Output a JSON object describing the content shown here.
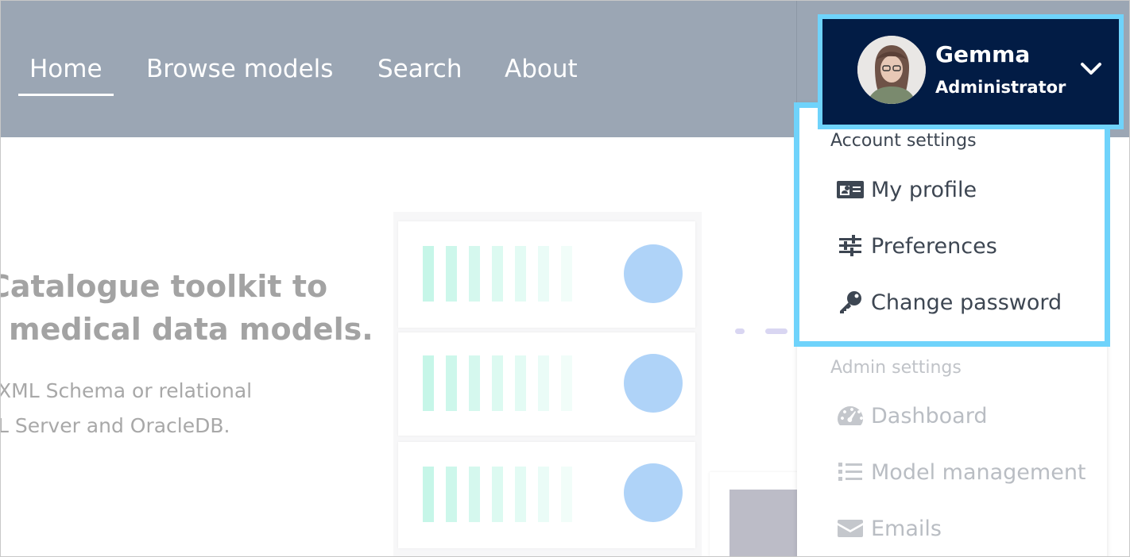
{
  "nav": {
    "items": [
      {
        "label": "Home",
        "active": true
      },
      {
        "label": "Browse models",
        "active": false
      },
      {
        "label": "Search",
        "active": false
      },
      {
        "label": "About",
        "active": false
      }
    ]
  },
  "user": {
    "name": "Gemma",
    "role": "Administrator",
    "avatar_icon": "avatar-photo",
    "chevron_icon": "chevron-down-icon"
  },
  "dropdown": {
    "account_section": {
      "label": "Account settings",
      "items": [
        {
          "label": "My profile",
          "icon": "id-card-icon"
        },
        {
          "label": "Preferences",
          "icon": "sliders-icon"
        },
        {
          "label": "Change password",
          "icon": "key-icon"
        }
      ]
    },
    "admin_section": {
      "label": "Admin settings",
      "items": [
        {
          "label": "Dashboard",
          "icon": "gauge-icon"
        },
        {
          "label": "Model management",
          "icon": "list-icon"
        },
        {
          "label": "Emails",
          "icon": "envelope-icon"
        }
      ]
    }
  },
  "hero": {
    "title_line1": "Catalogue toolkit to",
    "title_line2": "medical data models.",
    "sub_line1": "XML Schema or relational",
    "sub_line2": "L Server and OracleDB."
  },
  "colors": {
    "header_bg": "#9ba6b4",
    "user_box_bg": "#021c45",
    "highlight_border": "#6fd3fb",
    "disc": "#afd3f8"
  }
}
